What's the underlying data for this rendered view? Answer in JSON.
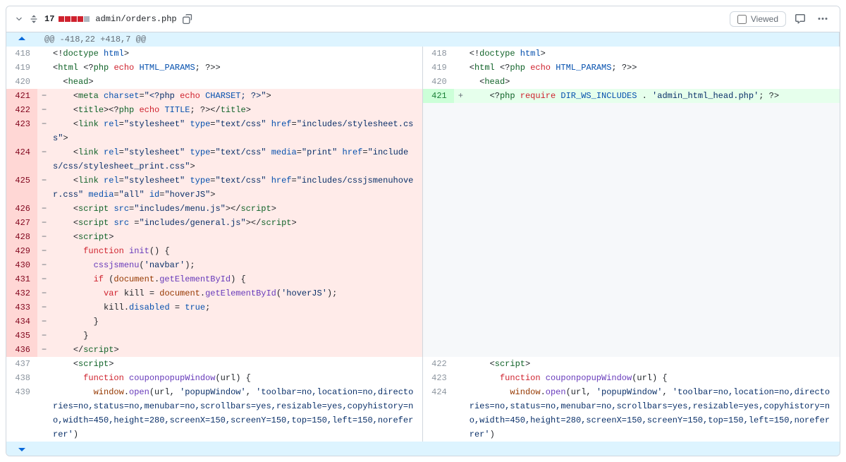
{
  "header": {
    "count": "17",
    "blocks": [
      "del",
      "del",
      "del",
      "del",
      "neutral"
    ],
    "filename": "admin/orders.php",
    "viewed_label": "Viewed"
  },
  "hunk": "@@ -418,22 +418,7 @@",
  "left_start": 418,
  "right_start": 418,
  "rows": [
    {
      "t": "ctx",
      "lh": "<span class='t-punc'>&lt;!</span><span class='t-tag'>doctype</span> <span class='t-attr'>html</span><span class='t-punc'>&gt;</span>",
      "rh": "<span class='t-punc'>&lt;!</span><span class='t-tag'>doctype</span> <span class='t-attr'>html</span><span class='t-punc'>&gt;</span>"
    },
    {
      "t": "ctx",
      "lh": "<span class='t-punc'>&lt;</span><span class='t-tag'>html</span> <span class='t-punc'>&lt;?</span><span class='t-tag'>php</span> <span class='t-kw'>echo</span> <span class='t-const'>HTML_PARAMS</span><span class='t-punc'>; ?&gt;&gt;</span>",
      "rh": "<span class='t-punc'>&lt;</span><span class='t-tag'>html</span> <span class='t-punc'>&lt;?</span><span class='t-tag'>php</span> <span class='t-kw'>echo</span> <span class='t-const'>HTML_PARAMS</span><span class='t-punc'>; ?&gt;&gt;</span>"
    },
    {
      "t": "ctx",
      "lh": "  <span class='t-punc'>&lt;</span><span class='t-tag'>head</span><span class='t-punc'>&gt;</span>",
      "rh": "  <span class='t-punc'>&lt;</span><span class='t-tag'>head</span><span class='t-punc'>&gt;</span>"
    },
    {
      "t": "pair",
      "lh": "    <span class='t-punc'>&lt;</span><span class='t-tag'>meta</span> <span class='t-attr'>charset</span>=<span class='t-str'>\"&lt;?php </span><span class='t-kw'>echo</span><span class='t-str'> </span><span class='t-const'>CHARSET</span><span class='t-str'>; ?&gt;\"</span><span class='t-punc'>&gt;</span>",
      "rh": "    <span class='t-punc'>&lt;?</span><span class='t-tag'>php</span> <span class='t-kw'>require</span> <span class='t-const'>DIR_WS_INCLUDES</span> <span class='t-punc'>.</span> <span class='t-str'>'admin_html_head.php'</span><span class='t-punc'>; ?&gt;</span>"
    },
    {
      "t": "del",
      "lh": "    <span class='t-punc'>&lt;</span><span class='t-tag'>title</span><span class='t-punc'>&gt;&lt;?</span><span class='t-tag'>php</span> <span class='t-kw'>echo</span> <span class='t-const'>TITLE</span><span class='t-punc'>; ?&gt;&lt;/</span><span class='t-tag'>title</span><span class='t-punc'>&gt;</span>"
    },
    {
      "t": "del",
      "lh": "    <span class='t-punc'>&lt;</span><span class='t-tag'>link</span> <span class='t-attr'>rel</span>=<span class='t-str'>\"stylesheet\"</span> <span class='t-attr'>type</span>=<span class='t-str'>\"text/css\"</span> <span class='t-attr'>href</span>=<span class='t-str'>\"includes/stylesheet.css\"</span><span class='t-punc'>&gt;</span>"
    },
    {
      "t": "del",
      "lh": "    <span class='t-punc'>&lt;</span><span class='t-tag'>link</span> <span class='t-attr'>rel</span>=<span class='t-str'>\"stylesheet\"</span> <span class='t-attr'>type</span>=<span class='t-str'>\"text/css\"</span> <span class='t-attr'>media</span>=<span class='t-str'>\"print\"</span> <span class='t-attr'>href</span>=<span class='t-str'>\"includes/css/stylesheet_print.css\"</span><span class='t-punc'>&gt;</span>"
    },
    {
      "t": "del",
      "lh": "    <span class='t-punc'>&lt;</span><span class='t-tag'>link</span> <span class='t-attr'>rel</span>=<span class='t-str'>\"stylesheet\"</span> <span class='t-attr'>type</span>=<span class='t-str'>\"text/css\"</span> <span class='t-attr'>href</span>=<span class='t-str'>\"includes/cssjsmenuhover.css\"</span> <span class='t-attr'>media</span>=<span class='t-str'>\"all\"</span> <span class='t-attr'>id</span>=<span class='t-str'>\"hoverJS\"</span><span class='t-punc'>&gt;</span>"
    },
    {
      "t": "del",
      "lh": "    <span class='t-punc'>&lt;</span><span class='t-tag'>script</span> <span class='t-attr'>src</span>=<span class='t-str'>\"includes/menu.js\"</span><span class='t-punc'>&gt;&lt;/</span><span class='t-tag'>script</span><span class='t-punc'>&gt;</span>"
    },
    {
      "t": "del",
      "lh": "    <span class='t-punc'>&lt;</span><span class='t-tag'>script</span> <span class='t-attr'>src </span>=<span class='t-str'>\"includes/general.js\"</span><span class='t-punc'>&gt;&lt;/</span><span class='t-tag'>script</span><span class='t-punc'>&gt;</span>"
    },
    {
      "t": "del",
      "lh": "    <span class='t-punc'>&lt;</span><span class='t-tag'>script</span><span class='t-punc'>&gt;</span>"
    },
    {
      "t": "del",
      "lh": "      <span class='t-kw'>function</span> <span class='t-fn'>init</span><span class='t-punc'>() {</span>"
    },
    {
      "t": "del",
      "lh": "        <span class='t-fn'>cssjsmenu</span><span class='t-punc'>(</span><span class='t-str'>'navbar'</span><span class='t-punc'>);</span>"
    },
    {
      "t": "del",
      "lh": "        <span class='t-kw'>if</span> <span class='t-punc'>(</span><span class='t-builtin'>document</span><span class='t-punc'>.</span><span class='t-fn'>getElementById</span><span class='t-punc'>) {</span>"
    },
    {
      "t": "del",
      "lh": "          <span class='t-kw'>var</span> kill <span class='t-punc'>=</span> <span class='t-builtin'>document</span><span class='t-punc'>.</span><span class='t-fn'>getElementById</span><span class='t-punc'>(</span><span class='t-str'>'hoverJS'</span><span class='t-punc'>);</span>"
    },
    {
      "t": "del",
      "lh": "          kill<span class='t-punc'>.</span><span class='t-const'>disabled</span> <span class='t-punc'>=</span> <span class='t-const'>true</span><span class='t-punc'>;</span>"
    },
    {
      "t": "del",
      "lh": "        <span class='t-punc'>}</span>"
    },
    {
      "t": "del",
      "lh": "      <span class='t-punc'>}</span>"
    },
    {
      "t": "del",
      "lh": "    <span class='t-punc'>&lt;/</span><span class='t-tag'>script</span><span class='t-punc'>&gt;</span>"
    },
    {
      "t": "ctx",
      "lh": "    <span class='t-punc'>&lt;</span><span class='t-tag'>script</span><span class='t-punc'>&gt;</span>",
      "rh": "    <span class='t-punc'>&lt;</span><span class='t-tag'>script</span><span class='t-punc'>&gt;</span>"
    },
    {
      "t": "ctx",
      "lh": "      <span class='t-kw'>function</span> <span class='t-fn'>couponpopupWindow</span><span class='t-punc'>(</span>url<span class='t-punc'>) {</span>",
      "rh": "      <span class='t-kw'>function</span> <span class='t-fn'>couponpopupWindow</span><span class='t-punc'>(</span>url<span class='t-punc'>) {</span>"
    },
    {
      "t": "ctx",
      "lh": "        <span class='t-builtin'>window</span><span class='t-punc'>.</span><span class='t-fn'>open</span><span class='t-punc'>(</span>url<span class='t-punc'>,</span> <span class='t-str'>'popupWindow'</span><span class='t-punc'>,</span> <span class='t-str'>'toolbar=no,location=no,directories=no,status=no,menubar=no,scrollbars=yes,resizable=yes,copyhistory=no,width=450,height=280,screenX=150,screenY=150,top=150,left=150,noreferrer'</span><span class='t-punc'>)</span>",
      "rh": "        <span class='t-builtin'>window</span><span class='t-punc'>.</span><span class='t-fn'>open</span><span class='t-punc'>(</span>url<span class='t-punc'>,</span> <span class='t-str'>'popupWindow'</span><span class='t-punc'>,</span> <span class='t-str'>'toolbar=no,location=no,directories=no,status=no,menubar=no,scrollbars=yes,resizable=yes,copyhistory=no,width=450,height=280,screenX=150,screenY=150,top=150,left=150,noreferrer'</span><span class='t-punc'>)</span>"
    }
  ]
}
